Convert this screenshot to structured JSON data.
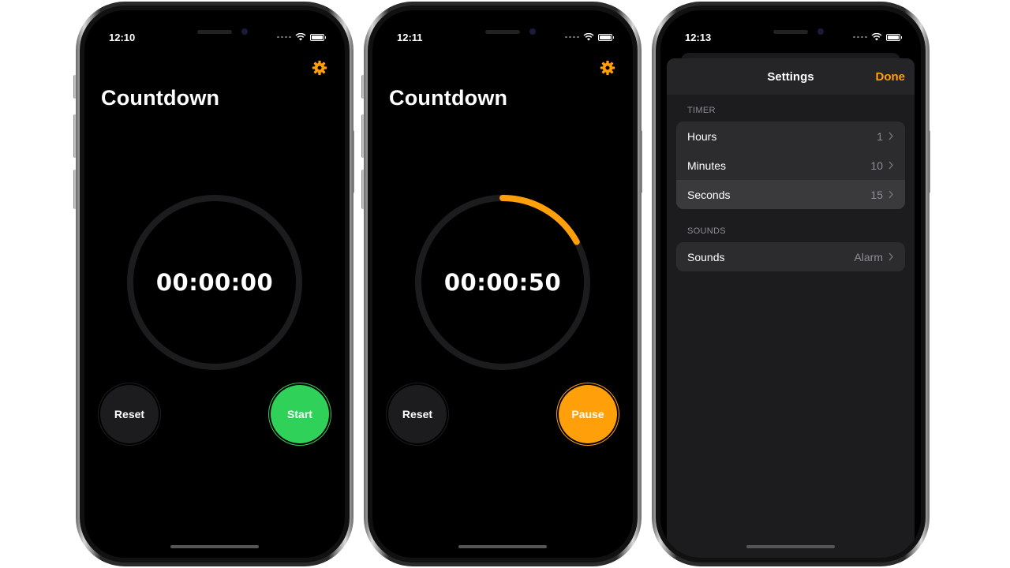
{
  "colors": {
    "accent": "#ff9f0a",
    "start_green": "#30d158",
    "ring_track": "#1c1c1e",
    "background": "#000000",
    "sheet": "#1c1c1e",
    "row": "#2c2c2e"
  },
  "screens": [
    {
      "status_time": "12:10",
      "title": "Countdown",
      "time_readout": "00:00:00",
      "progress_fraction": 0,
      "reset_label": "Reset",
      "primary_label": "Start",
      "settings_icon": "gear-icon"
    },
    {
      "status_time": "12:11",
      "title": "Countdown",
      "time_readout": "00:00:50",
      "progress_fraction": 0.17,
      "reset_label": "Reset",
      "primary_label": "Pause",
      "settings_icon": "gear-icon"
    },
    {
      "status_time": "12:13",
      "sheet_title": "Settings",
      "done_label": "Done",
      "sections": [
        {
          "header": "TIMER",
          "rows": [
            {
              "label": "Hours",
              "value": "1",
              "selected": false
            },
            {
              "label": "Minutes",
              "value": "10",
              "selected": false
            },
            {
              "label": "Seconds",
              "value": "15",
              "selected": true
            }
          ]
        },
        {
          "header": "SOUNDS",
          "rows": [
            {
              "label": "Sounds",
              "value": "Alarm",
              "selected": false
            }
          ]
        }
      ]
    }
  ]
}
